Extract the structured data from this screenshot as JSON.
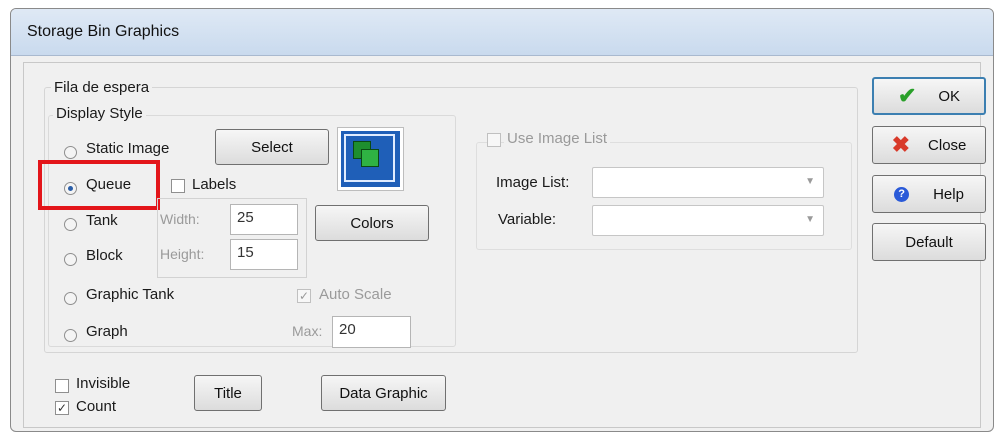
{
  "window": {
    "title": "Storage Bin Graphics"
  },
  "dialog": {
    "name": "Fila de espera",
    "display_style": {
      "label": "Display Style",
      "options": [
        "Static Image",
        "Queue",
        "Tank",
        "Block",
        "Graphic Tank",
        "Graph"
      ],
      "selected": "Queue"
    },
    "select_button": "Select",
    "labels_checkbox": {
      "label": "Labels",
      "checked": false
    },
    "width": {
      "label": "Width:",
      "value": "25"
    },
    "height": {
      "label": "Height:",
      "value": "15"
    },
    "colors_button": "Colors",
    "auto_scale": {
      "label": "Auto Scale",
      "checked": true
    },
    "max": {
      "label": "Max:",
      "value": "20"
    },
    "use_image_list": {
      "label": "Use Image List",
      "checked": false
    },
    "image_list": {
      "label": "Image List:",
      "value": ""
    },
    "variable": {
      "label": "Variable:",
      "value": ""
    },
    "invisible": {
      "label": "Invisible",
      "checked": false
    },
    "count": {
      "label": "Count",
      "checked": true
    },
    "title_button": "Title",
    "data_graphic_button": "Data Graphic"
  },
  "side_buttons": {
    "ok": "OK",
    "close": "Close",
    "help": "Help",
    "default": "Default"
  },
  "colors": {
    "highlight": "#e3151a",
    "ok_check": "#2aa02a",
    "close_x": "#d83a2a",
    "help_icon": "#2a5ad8"
  },
  "icons": {
    "ok": "check-icon",
    "close": "x-icon",
    "help": "help-icon",
    "preview": "stacked-squares-icon"
  }
}
